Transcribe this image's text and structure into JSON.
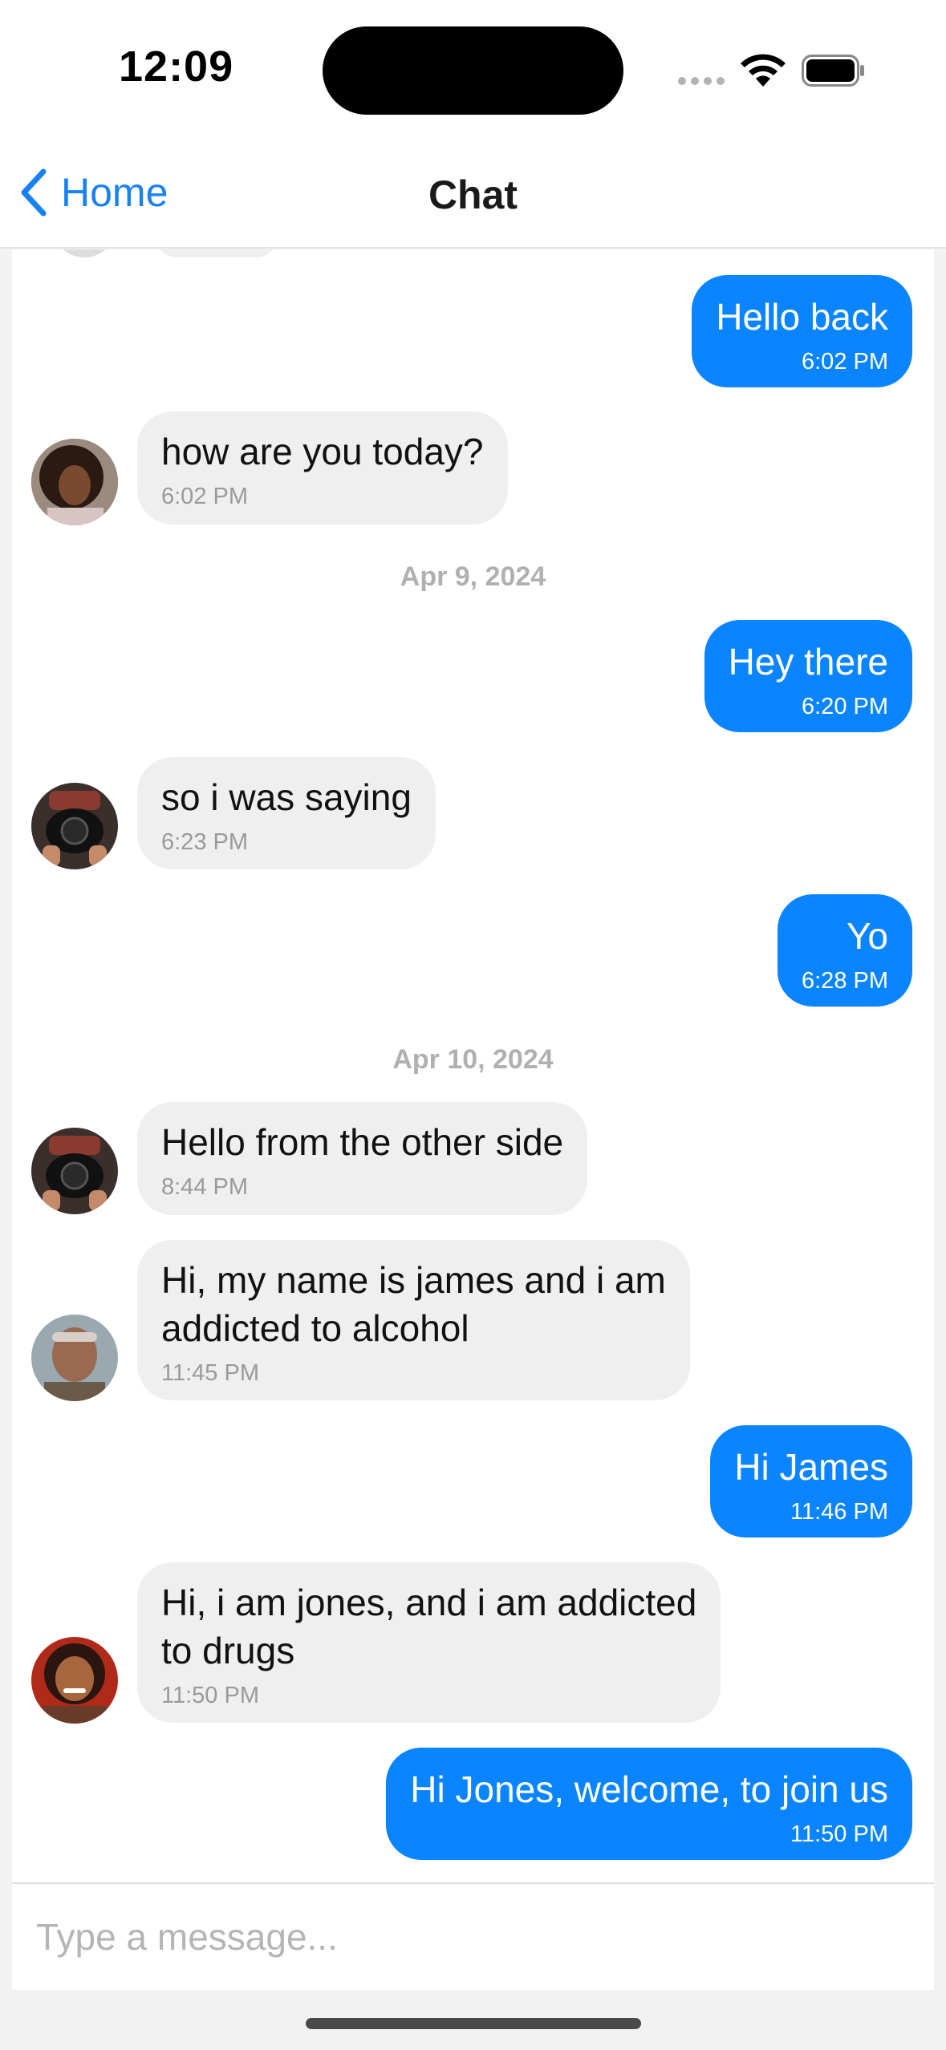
{
  "status_bar": {
    "time": "12:09",
    "icons": [
      "cellular-signal-icon",
      "wifi-icon",
      "battery-icon"
    ]
  },
  "nav": {
    "back_label": "Home",
    "title": "Chat"
  },
  "colors": {
    "accent": "#0a84ff",
    "incoming_bubble": "#efefef",
    "date_label": "#b0b0b0"
  },
  "messages": [
    {
      "direction": "out",
      "text": "Hello back",
      "time": "6:02 PM"
    },
    {
      "direction": "in",
      "text": "how are you today?",
      "time": "6:02 PM",
      "avatar": "avatar-girl"
    },
    {
      "date": "Apr 9, 2024"
    },
    {
      "direction": "out",
      "text": "Hey there",
      "time": "6:20 PM"
    },
    {
      "direction": "in",
      "text": "so i was saying",
      "time": "6:23 PM",
      "avatar": "avatar-camera-man"
    },
    {
      "direction": "out",
      "text": "Yo",
      "time": "6:28 PM"
    },
    {
      "date": "Apr 10, 2024"
    },
    {
      "direction": "in",
      "text": "Hello from the other side",
      "time": "8:44 PM",
      "avatar": "avatar-camera-man"
    },
    {
      "direction": "in",
      "text": "Hi, my name is james and i am\naddicted to alcohol",
      "time": "11:45 PM",
      "avatar": "avatar-older-man"
    },
    {
      "direction": "out",
      "text": "Hi James",
      "time": "11:46 PM"
    },
    {
      "direction": "in",
      "text": "Hi, i am jones, and i am addicted\nto drugs",
      "time": "11:50 PM",
      "avatar": "avatar-woman"
    },
    {
      "direction": "out",
      "text": "Hi Jones, welcome, to join us",
      "time": "11:50 PM"
    }
  ],
  "composer": {
    "placeholder": "Type a message..."
  }
}
